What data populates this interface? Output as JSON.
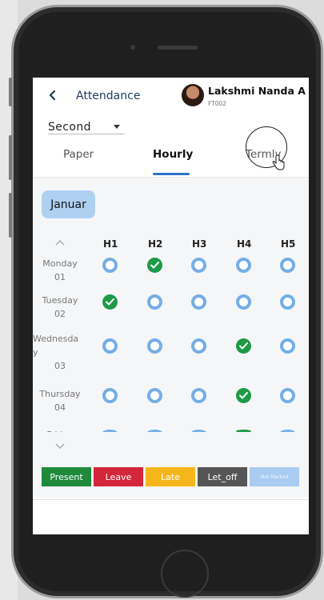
{
  "header": {
    "title": "Attendance",
    "user_name": "Lakshmi Nanda A",
    "user_id": "FT002"
  },
  "filter": {
    "selected": "Second"
  },
  "tabs": [
    {
      "label": "Paper",
      "active": false
    },
    {
      "label": "Hourly",
      "active": true
    },
    {
      "label": "Termly",
      "active": false
    }
  ],
  "month": "Januar",
  "hours": [
    "H1",
    "H2",
    "H3",
    "H4",
    "H5"
  ],
  "days": [
    {
      "name": "Monday",
      "date": "01",
      "marks": [
        0,
        1,
        0,
        0,
        0
      ]
    },
    {
      "name": "Tuesday",
      "date": "02",
      "marks": [
        1,
        0,
        0,
        0,
        0
      ]
    },
    {
      "name": "Wednesda\ny",
      "date": "03",
      "marks": [
        0,
        0,
        0,
        1,
        0
      ]
    },
    {
      "name": "Thursday",
      "date": "04",
      "marks": [
        0,
        0,
        0,
        1,
        0
      ]
    },
    {
      "name": "Friday",
      "date": "",
      "marks": [
        0,
        0,
        0,
        1,
        0
      ]
    }
  ],
  "legend": [
    {
      "label": "Present",
      "color": "#1f8a3c"
    },
    {
      "label": "Leave",
      "color": "#d3263a"
    },
    {
      "label": "Late",
      "color": "#f5b61c"
    },
    {
      "label": "Let_off",
      "color": "#555555"
    },
    {
      "label": "Not Marked",
      "color": "#a9ccf0"
    }
  ]
}
